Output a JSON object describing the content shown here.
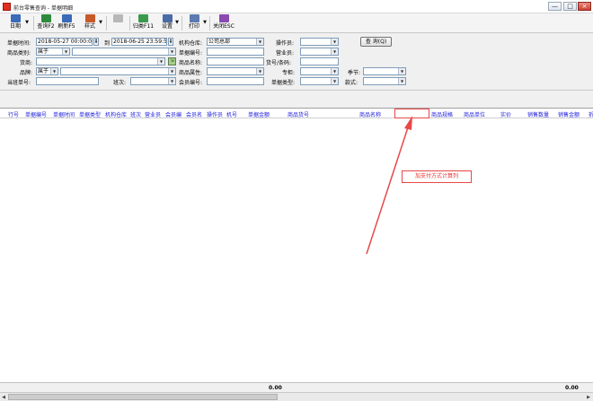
{
  "window": {
    "title": "前台零售查询 - 单据明细",
    "min": "—",
    "max": "□",
    "close": "×"
  },
  "toolbar": [
    {
      "label": "日期",
      "icon": "calendar-icon",
      "color": "#3a6ab8",
      "arrow": true,
      "enabled": true
    },
    {
      "label": "查询F2",
      "icon": "search-icon",
      "color": "#2e8a3e",
      "enabled": true
    },
    {
      "label": "刷新F5",
      "icon": "refresh-icon",
      "color": "#3a6ab8",
      "enabled": true
    },
    {
      "label": "样式",
      "icon": "style-icon",
      "color": "#c85a28",
      "arrow": true,
      "enabled": true
    },
    {
      "label": "",
      "icon": "disabled-tool-icon",
      "color": "#b8b8b8",
      "enabled": false
    },
    {
      "label": "归类F11",
      "icon": "group-icon",
      "color": "#3a9a4a",
      "enabled": true
    },
    {
      "label": "设置",
      "icon": "settings-icon",
      "color": "#4a6aa8",
      "arrow": true,
      "enabled": true
    },
    {
      "label": "打印",
      "icon": "print-icon",
      "color": "#5a7ab0",
      "arrow": true,
      "enabled": true
    },
    {
      "label": "关闭ESC",
      "icon": "close-door-icon",
      "color": "#8a4ab0",
      "enabled": true
    }
  ],
  "filters": {
    "doc_time_label": "单据时间:",
    "date_from": "2018-05-27 00:00:00",
    "to_label": "到",
    "date_to": "2018-06-25 23:59:59",
    "warehouse_label": "机构仓库:",
    "warehouse_value": "公司总部",
    "operator_label": "操作员:",
    "query_button": "查 询(Q)",
    "category_label": "商品类别:",
    "category_mode": "属于",
    "doc_no_label": "单据编号:",
    "salesperson_label": "营业员:",
    "supplier_label": "货商:",
    "product_name_label": "商品名称:",
    "barcode_label": "货号/条码:",
    "brand_label": "品牌:",
    "brand_mode": "属于",
    "attr_label": "商品属性:",
    "counter_label": "专柜:",
    "season_label": "季节:",
    "shift_no_label": "当班单号:",
    "shift_label": "班次:",
    "member_no_label": "会员编号:",
    "doc_type_label": "单据类型:",
    "style_label": "款式:"
  },
  "columns": [
    "行号",
    "单据编号",
    "单据时间",
    "单据类型",
    "机构仓库",
    "班次",
    "营业员",
    "会员编",
    "会员名",
    "操作员",
    "机号",
    "单据金额",
    "商品货号",
    "商品名称",
    "",
    "商品规格",
    "商品单位",
    "实价",
    "销售数量",
    "销售金额",
    "折"
  ],
  "annotation": {
    "text": "加支付方式计算列",
    "color": "#e83030"
  },
  "footer": {
    "total_qty": "0.00",
    "total_amount": "0.00"
  }
}
